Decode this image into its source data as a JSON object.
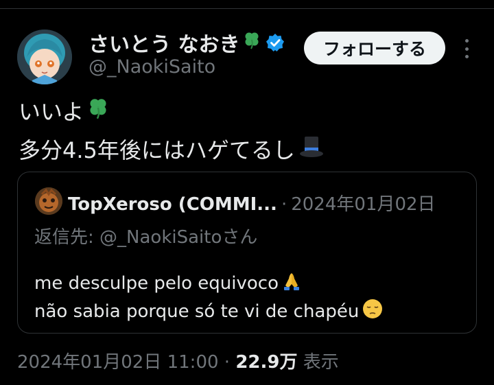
{
  "post": {
    "author": {
      "name": "さいとう なおき",
      "handle": "@_NaokiSaito",
      "verified": true
    },
    "follow_label": "フォローする",
    "text_line1": "いいよ",
    "text_line2": "多分4.5年後にはハゲてるし",
    "emoji": {
      "line1": "four-leaf-clover-icon",
      "line2": "top-hat-icon"
    },
    "quote": {
      "author_name": "TopXeroso (COMMI...",
      "separator": "·",
      "date": "2024年01月02日",
      "reply_prefix": "返信先: ",
      "reply_handle": "@_NaokiSaito",
      "reply_suffix": "さん",
      "text_line1": "me desculpe pelo equivoco",
      "text_line2": "não sabia porque só te vi de chapéu"
    },
    "meta": {
      "timestamp": "2024年01月02日 11:00",
      "separator": "·",
      "views": "22.9万",
      "views_label": "表示"
    }
  },
  "colors": {
    "background": "#000000",
    "text_primary": "#e7e9ea",
    "text_secondary": "#71767b",
    "border": "#2f3336",
    "verified_blue": "#1d9bf0",
    "clover_green": "#3aa757"
  }
}
